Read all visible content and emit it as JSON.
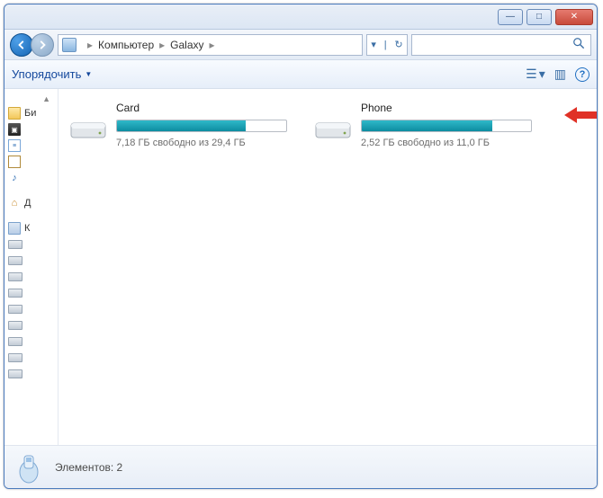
{
  "titlebar": {
    "min": "—",
    "max": "□",
    "close": "✕"
  },
  "breadcrumb": {
    "root_sep": "▸",
    "seg1": "Компьютер",
    "seg2": "Galaxy",
    "tail_sep": "▸"
  },
  "refresh": {
    "down": "▾",
    "sep": "|",
    "reload": "↻"
  },
  "toolbar": {
    "organize": "Упорядочить",
    "drop": "▼",
    "view_badge": "☰",
    "view_drop": "▾",
    "preview": "▥",
    "help": "?"
  },
  "sidebar": {
    "scrolltop": "▲",
    "lib_label": "Би",
    "home_label": "Д",
    "comp_label": "К"
  },
  "drives": [
    {
      "name": "Card",
      "status": "7,18 ГБ свободно из 29,4 ГБ",
      "fill_pct": 76
    },
    {
      "name": "Phone",
      "status": "2,52 ГБ свободно из 11,0 ГБ",
      "fill_pct": 77
    }
  ],
  "statusbar": {
    "text": "Элементов: 2"
  }
}
